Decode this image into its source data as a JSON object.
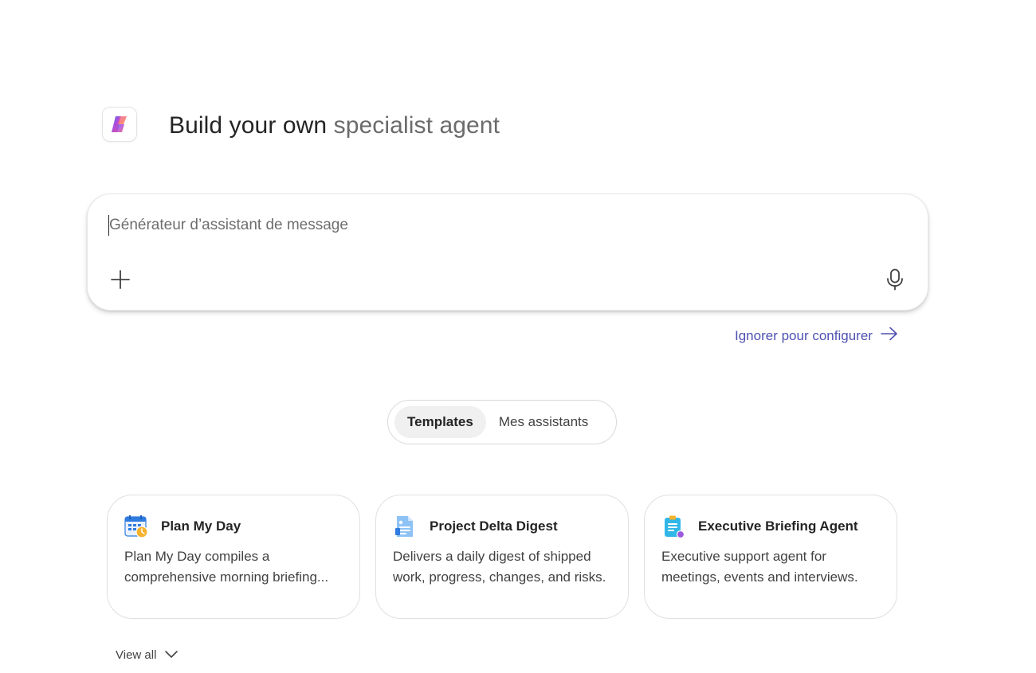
{
  "header": {
    "logo_icon": "copilot-logo-icon",
    "title_strong": "Build your own",
    "title_light": "specialist agent"
  },
  "composer": {
    "value": "",
    "placeholder": "Générateur d’assistant de message",
    "add_icon": "plus-icon",
    "mic_icon": "microphone-icon"
  },
  "skip_link": {
    "label": "Ignorer pour configurer",
    "icon": "arrow-right-icon"
  },
  "tabs": [
    {
      "label": "Templates",
      "active": true
    },
    {
      "label": "Mes assistants",
      "active": false
    }
  ],
  "cards": [
    {
      "title": "Plan My Day",
      "description": "Plan My Day compiles a comprehensive morning briefing...",
      "icon": "calendar-clock-icon"
    },
    {
      "title": "Project Delta Digest",
      "description": "Delivers a daily digest of shipped work, progress, changes, and risks.",
      "icon": "document-digest-icon"
    },
    {
      "title": "Executive Briefing Agent",
      "description": "Executive support agent for meetings, events and interviews.",
      "icon": "clipboard-briefing-icon"
    }
  ],
  "view_all": {
    "label": "View all",
    "icon": "chevron-down-icon"
  },
  "colors": {
    "accent": "#4f52b2",
    "text_primary": "#242424",
    "text_secondary": "#424242",
    "border": "#e0e0e0"
  }
}
